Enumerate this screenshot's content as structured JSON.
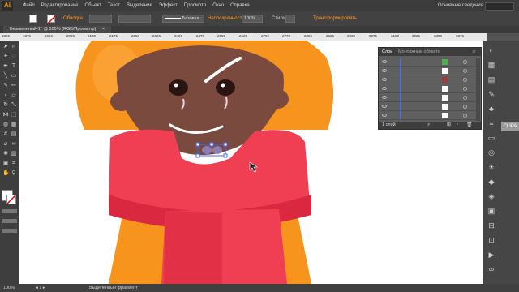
{
  "app": {
    "logo": "Ai"
  },
  "menu": {
    "items": [
      "Файл",
      "Редактирование",
      "Объект",
      "Текст",
      "Выделение",
      "Эффект",
      "Просмотр",
      "Окно",
      "Справка"
    ]
  },
  "workspace": {
    "label": "Основные сведения"
  },
  "control": {
    "obvodka_label": "Обводка",
    "stroke_style": "Базовая",
    "opacity_label": "Непрозрачность",
    "opacity_value": "100%",
    "styles_label": "Стили",
    "transform_label": "Трансформировать"
  },
  "document": {
    "tab_label": "Безымянный-1* @ 100% (RGB/Просмотр)"
  },
  "ruler": {
    "ticks": [
      "1800",
      "1875",
      "1950",
      "2025",
      "2100",
      "2175",
      "2250",
      "2325",
      "2400",
      "2475",
      "2550",
      "2625",
      "2700",
      "2775",
      "2850",
      "2925",
      "3000",
      "3075",
      "3150",
      "3225",
      "3300",
      "3375"
    ]
  },
  "layers_panel": {
    "tab_layers": "Слои",
    "tab_artboards": "Монтажные области",
    "footer_count": "1 слой"
  },
  "watermark": "CLIPA",
  "status": {
    "zoom": "100%",
    "selection": "Выделенный фрагмент"
  },
  "colors": {
    "accent": "#ff9a00",
    "orange_hood": "#f7941d",
    "orange_light": "#ffb347",
    "skin": "#7a4a3f",
    "scarf": "#f03e52",
    "scarf_dark": "#d9283f",
    "selection_blue": "#3f6cff"
  }
}
